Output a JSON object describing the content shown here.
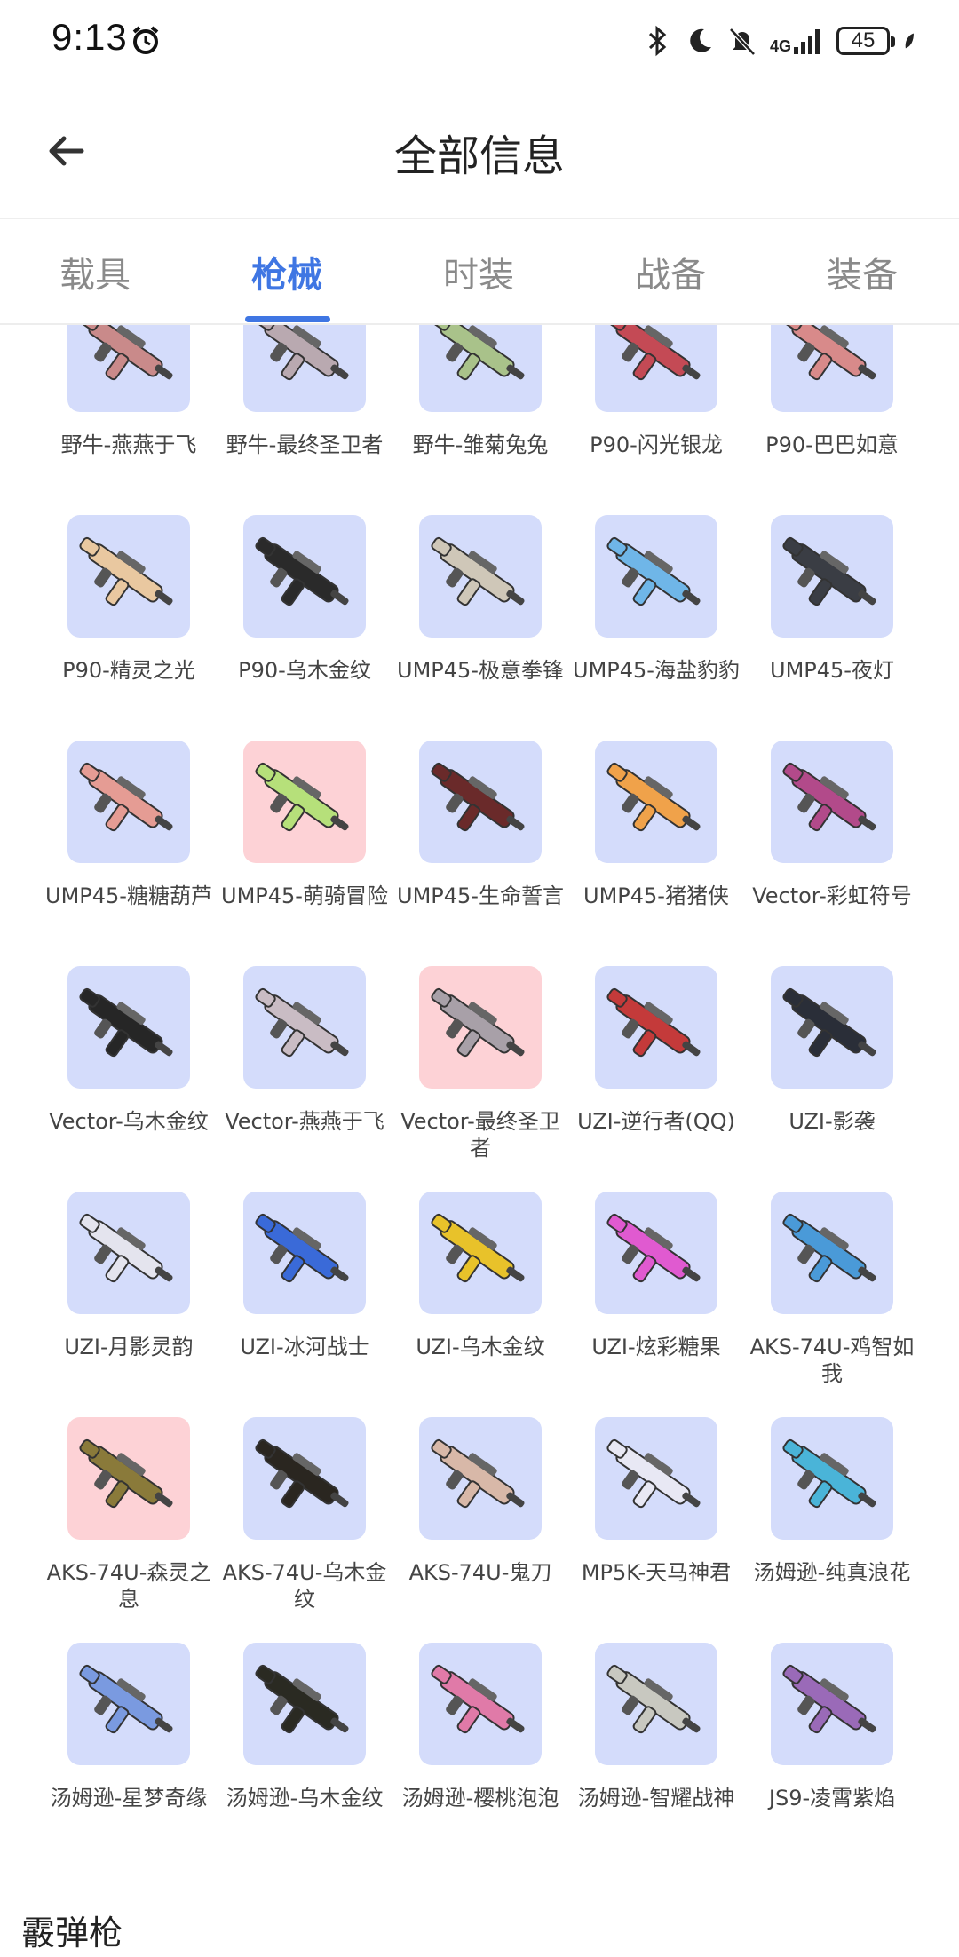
{
  "status_bar": {
    "time": "9:13",
    "network": "4G",
    "battery": "45"
  },
  "header": {
    "title": "全部信息"
  },
  "tabs": [
    {
      "label": "载具"
    },
    {
      "label": "枪械",
      "active": true
    },
    {
      "label": "时装"
    },
    {
      "label": "战备"
    },
    {
      "label": "装备"
    }
  ],
  "items": [
    {
      "label": "野牛-燕燕于飞",
      "bg": "blue",
      "color": "#c98a8a"
    },
    {
      "label": "野牛-最终圣卫者",
      "bg": "blue",
      "color": "#b9a9b0"
    },
    {
      "label": "野牛-雏菊兔兔",
      "bg": "blue",
      "color": "#a9c28a"
    },
    {
      "label": "P90-闪光银龙",
      "bg": "blue",
      "color": "#c44a55"
    },
    {
      "label": "P90-巴巴如意",
      "bg": "blue",
      "color": "#d88a8a"
    },
    {
      "label": "P90-精灵之光",
      "bg": "blue",
      "color": "#e9c8a0"
    },
    {
      "label": "P90-乌木金纹",
      "bg": "blue",
      "color": "#2a2a2a"
    },
    {
      "label": "UMP45-极意拳锋",
      "bg": "blue",
      "color": "#cfc7b8"
    },
    {
      "label": "UMP45-海盐豹豹",
      "bg": "blue",
      "color": "#6fb6e8"
    },
    {
      "label": "UMP45-夜灯",
      "bg": "blue",
      "color": "#3a3d44"
    },
    {
      "label": "UMP45-糖糖葫芦",
      "bg": "blue",
      "color": "#e59c94"
    },
    {
      "label": "UMP45-萌骑冒险",
      "bg": "pink",
      "color": "#b6e07a"
    },
    {
      "label": "UMP45-生命誓言",
      "bg": "blue",
      "color": "#6a2a2a"
    },
    {
      "label": "UMP45-猪猪侠",
      "bg": "blue",
      "color": "#f0a24a"
    },
    {
      "label": "Vector-彩虹符号",
      "bg": "blue",
      "color": "#b24a8a"
    },
    {
      "label": "Vector-乌木金纹",
      "bg": "blue",
      "color": "#262626"
    },
    {
      "label": "Vector-燕燕于飞",
      "bg": "blue",
      "color": "#c9bcc4"
    },
    {
      "label": "Vector-最终圣卫者",
      "bg": "pink",
      "color": "#a8a0a8"
    },
    {
      "label": "UZI-逆行者(QQ)",
      "bg": "blue",
      "color": "#c43a3a"
    },
    {
      "label": "UZI-影袭",
      "bg": "blue",
      "color": "#2a2e38"
    },
    {
      "label": "UZI-月影灵韵",
      "bg": "blue",
      "color": "#e4e4ee"
    },
    {
      "label": "UZI-冰河战士",
      "bg": "blue",
      "color": "#3a6ad8"
    },
    {
      "label": "UZI-乌木金纹",
      "bg": "blue",
      "color": "#e8c22a"
    },
    {
      "label": "UZI-炫彩糖果",
      "bg": "blue",
      "color": "#e05ad0"
    },
    {
      "label": "AKS-74U-鸡智如我",
      "bg": "blue",
      "color": "#4a9ad8"
    },
    {
      "label": "AKS-74U-森灵之息",
      "bg": "pink",
      "color": "#8a7a3a"
    },
    {
      "label": "AKS-74U-乌木金纹",
      "bg": "blue",
      "color": "#2a2620"
    },
    {
      "label": "AKS-74U-鬼刀",
      "bg": "blue",
      "color": "#d8b8a8"
    },
    {
      "label": "MP5K-天马神君",
      "bg": "blue",
      "color": "#e8e8f4"
    },
    {
      "label": "汤姆逊-纯真浪花",
      "bg": "blue",
      "color": "#4ab4d8"
    },
    {
      "label": "汤姆逊-星梦奇缘",
      "bg": "blue",
      "color": "#7a9ae0"
    },
    {
      "label": "汤姆逊-乌木金纹",
      "bg": "blue",
      "color": "#2a2a22"
    },
    {
      "label": "汤姆逊-樱桃泡泡",
      "bg": "blue",
      "color": "#e07aa8"
    },
    {
      "label": "汤姆逊-智耀战神",
      "bg": "blue",
      "color": "#c8c8c0"
    },
    {
      "label": "JS9-凌霄紫焰",
      "bg": "blue",
      "color": "#9a6ab8"
    }
  ],
  "section": {
    "next_title": "霰弹枪"
  }
}
